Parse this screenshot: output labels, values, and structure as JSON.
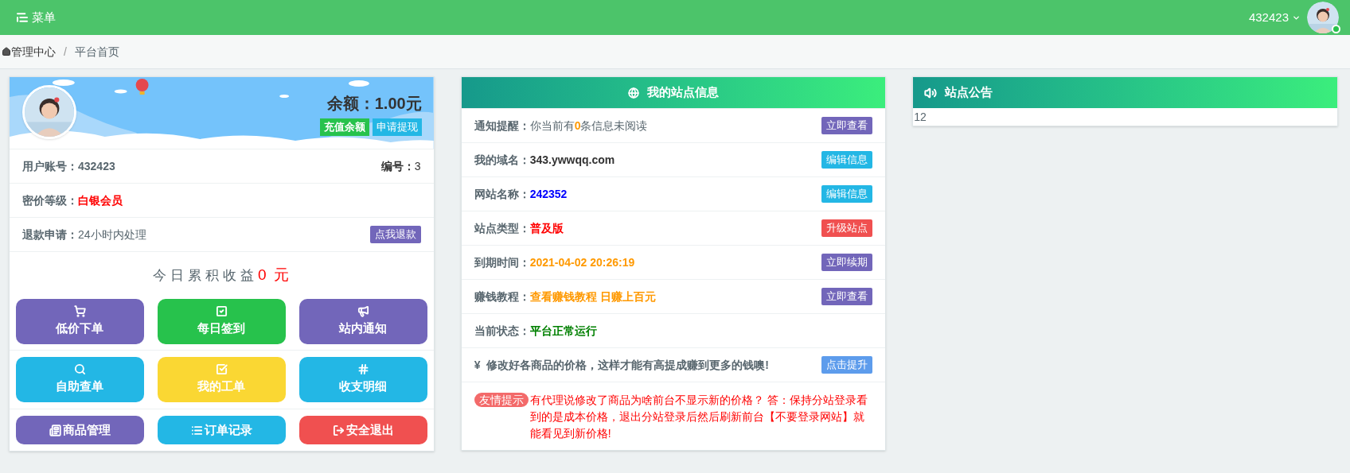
{
  "topbar": {
    "menu_label": "菜单",
    "user": "432423",
    "online": true
  },
  "breadcrumb": [
    {
      "label": "管理中心"
    },
    {
      "separator": "/",
      "label": "平台首页"
    }
  ],
  "account": {
    "balance": "余额：1.00元",
    "actions": [
      {
        "label": "充值余额",
        "color": "#27c24c"
      },
      {
        "label": "申请提现",
        "color": "#23b7e5"
      }
    ],
    "rows": [
      {
        "label": "用户账号：",
        "value": "432423",
        "color": "#58666e",
        "extra_label": "编号：",
        "extra_value": "3"
      },
      {
        "label": "密价等级：",
        "value": "白银会员",
        "color": "#ff0000"
      },
      {
        "label": "退款申请：",
        "value": "24小时内处理",
        "color": "#58666e",
        "plain": true,
        "button": {
          "label": "点我退款",
          "color": "#7266ba"
        }
      }
    ],
    "earnings": {
      "label": "今日累积收益",
      "value": "0 元"
    },
    "buttons": [
      {
        "kind": "tile",
        "label": "低价下单",
        "color": "#7266ba"
      },
      {
        "kind": "tile",
        "label": "每日签到",
        "color": "#27c24c"
      },
      {
        "kind": "tile",
        "label": "站内通知",
        "color": "#7266ba"
      },
      {
        "kind": "tile",
        "label": "自助查单",
        "color": "#23b7e5"
      },
      {
        "kind": "tile",
        "label": "我的工单",
        "color": "#fad733"
      },
      {
        "kind": "tile",
        "label": "收支明细",
        "color": "#23b7e5"
      },
      {
        "kind": "inline",
        "label": "商品管理",
        "color": "#7266ba"
      },
      {
        "kind": "inline",
        "label": "订单记录",
        "color": "#23b7e5"
      },
      {
        "kind": "inline",
        "label": "安全退出",
        "color": "#f05050"
      }
    ]
  },
  "site_info": {
    "title": "我的站点信息",
    "rows": [
      {
        "kind": "field",
        "label": "通知提醒：",
        "value": "你当前有**0**条信息未阅读",
        "color": "#58666e",
        "plain": true,
        "button": {
          "label": "立即查看",
          "color": "#7266ba"
        }
      },
      {
        "kind": "field",
        "label": "我的域名：",
        "value": "343.ywwqq.com",
        "color": "#333333",
        "button": {
          "label": "编辑信息",
          "color": "#23b7e5"
        }
      },
      {
        "kind": "field",
        "label": "网站名称：",
        "value": "242352",
        "color": "#0000ff",
        "button": {
          "label": "编辑信息",
          "color": "#23b7e5"
        }
      },
      {
        "kind": "field",
        "label": "站点类型：",
        "value": "普及版",
        "color": "#ff0000",
        "button": {
          "label": "升级站点",
          "color": "#f05050"
        }
      },
      {
        "kind": "field",
        "label": "到期时间：",
        "value": "2021-04-02 20:26:19",
        "color": "#ff9900",
        "button": {
          "label": "立即续期",
          "color": "#7266ba"
        }
      },
      {
        "kind": "field",
        "label": "赚钱教程：",
        "value": "查看赚钱教程 日赚上百元",
        "color": "#ff9900",
        "button": {
          "label": "立即查看",
          "color": "#7266ba"
        }
      },
      {
        "kind": "field",
        "label": "当前状态：",
        "value": "平台正常运行",
        "color": "#008000"
      },
      {
        "kind": "notice",
        "value": "¥  修改好各商品的价格，这样才能有高提成赚到更多的钱噢!",
        "color": "#58666e",
        "button": {
          "label": "点击提升",
          "color": "#5d9cec"
        }
      },
      {
        "kind": "tip",
        "badge": "友情提示",
        "value": "有代理说修改了商品为啥前台不显示新的价格？ 答：保持分站登录看到的是成本价格，退出分站登录后然后刷新前台【不要登录网站】就能看见到新价格!",
        "color": "#ff0000"
      }
    ]
  },
  "announcement": {
    "title": "站点公告",
    "body": "12"
  }
}
